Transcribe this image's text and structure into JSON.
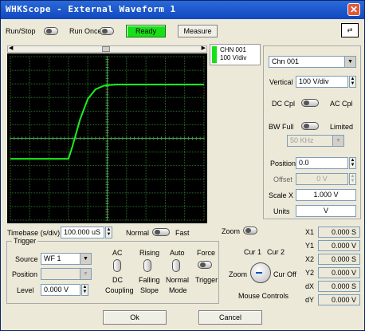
{
  "window": {
    "title": "WHKScope - External Waveform 1"
  },
  "toolbar": {
    "run_stop": "Run/Stop",
    "run_once": "Run Once",
    "ready": "Ready",
    "measure": "Measure",
    "ready_color": "#18e018"
  },
  "channel_tag": {
    "name": "CHN 001",
    "scale": "100 V/div",
    "color": "#16e016"
  },
  "channel_panel": {
    "channel": "Chn 001",
    "vertical_label": "Vertical",
    "vertical": "100 V/div",
    "dc_cpl": "DC Cpl",
    "ac_cpl": "AC Cpl",
    "bw_full": "BW Full",
    "limited": "Limited",
    "bw_value": "50 KHz",
    "position_label": "Position",
    "position": "0.0",
    "offset_label": "Offset",
    "offset": "0 V",
    "scale_x_label": "Scale X",
    "scale_x": "1.000 V",
    "units_label": "Units",
    "units": "V"
  },
  "timebase": {
    "label": "Timebase (s/div)",
    "value": "100.000 uS",
    "normal": "Normal",
    "fast": "Fast"
  },
  "zoom": {
    "label": "Zoom"
  },
  "trigger": {
    "group": "Trigger",
    "source_label": "Source",
    "source": "WF 1",
    "position_label": "Position",
    "position": "",
    "level_label": "Level",
    "level": "0.000 V",
    "coupling_top": "AC",
    "coupling_bottom": "DC",
    "coupling_label": "Coupling",
    "slope_top": "Rising",
    "slope_bottom": "Falling",
    "slope_label": "Slope",
    "mode_top": "Auto",
    "mode_bottom": "Normal",
    "mode_label": "Mode",
    "force": "Force",
    "force_trigger": "Trigger"
  },
  "mouse": {
    "cur1": "Cur 1",
    "cur2": "Cur 2",
    "zoom": "Zoom",
    "cur_off": "Cur Off",
    "label": "Mouse Controls"
  },
  "readouts": [
    {
      "label": "X1",
      "value": "0.000 S"
    },
    {
      "label": "Y1",
      "value": "0.000 V"
    },
    {
      "label": "X2",
      "value": "0.000 S"
    },
    {
      "label": "Y2",
      "value": "0.000 V"
    },
    {
      "label": "dX",
      "value": "0.000 S"
    },
    {
      "label": "dY",
      "value": "0.000 V"
    }
  ],
  "footer": {
    "ok": "Ok",
    "cancel": "Cancel"
  },
  "chart_data": {
    "type": "line",
    "x": [
      0,
      0.5,
      1,
      1.5,
      2,
      2.5,
      3,
      3.2,
      3.6,
      4.0,
      4.4,
      4.8,
      5,
      5.5,
      6,
      7,
      8,
      9,
      10
    ],
    "y": [
      0.5,
      0.5,
      0.5,
      0.5,
      0.5,
      0.5,
      0.5,
      1.4,
      3.4,
      4.9,
      5.6,
      5.85,
      5.9,
      5.95,
      5.95,
      5.95,
      5.95,
      5.95,
      5.95
    ],
    "xlim": [
      0,
      10
    ],
    "ylim": [
      -4,
      8
    ],
    "grid": true,
    "trace_color": "#1aef1a",
    "grid_color": "#2a6e2a"
  }
}
